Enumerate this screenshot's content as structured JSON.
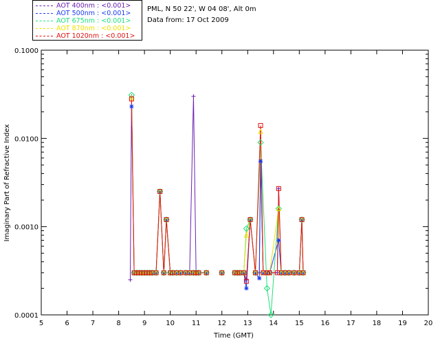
{
  "header": {
    "location": "PML, N 50 22', W 04 08', Alt 0m",
    "date_line": "Data from: 17 Oct 2009"
  },
  "legend": [
    {
      "label": "AOT  400nm : <0.001>",
      "color": "#6a1fb0"
    },
    {
      "label": "AOT  500nm : <0.001>",
      "color": "#1a3cf0"
    },
    {
      "label": "AOT  675nm : <0.001>",
      "color": "#1ee07a"
    },
    {
      "label": "AOT  870nm : <0.001>",
      "color": "#f0e000"
    },
    {
      "label": "AOT 1020nm : <0.001>",
      "color": "#e01010"
    }
  ],
  "chart_data": {
    "type": "line",
    "xlabel": "Time (GMT)",
    "ylabel": "Imaginary Part of Refractive Index",
    "xlim": [
      5,
      20
    ],
    "ylim": [
      0.0001,
      0.1
    ],
    "yscale": "log",
    "xticks": [
      "5",
      "6",
      "7",
      "8",
      "9",
      "10",
      "11",
      "12",
      "13",
      "14",
      "15",
      "16",
      "17",
      "18",
      "19",
      "20"
    ],
    "yticks": [
      {
        "value": 0.0001,
        "label": "0.0001"
      },
      {
        "value": 0.001,
        "label": "0.0010"
      },
      {
        "value": 0.01,
        "label": "0.0100"
      },
      {
        "value": 0.1,
        "label": "0.1000"
      }
    ],
    "series": [
      {
        "name": "AOT  400nm : <0.001>",
        "color": "#6a1fb0",
        "marker": "plus",
        "points": [
          [
            8.45,
            0.00025
          ],
          [
            8.5,
            0.03
          ],
          [
            8.6,
            0.0003
          ],
          [
            8.7,
            0.0003
          ],
          [
            8.8,
            0.0003
          ],
          [
            8.9,
            0.0003
          ],
          [
            9.0,
            0.0003
          ],
          [
            9.1,
            0.0003
          ],
          [
            9.2,
            0.0003
          ],
          [
            9.3,
            0.0003
          ],
          [
            9.45,
            0.0003
          ],
          [
            9.6,
            0.0025
          ],
          [
            9.75,
            0.0003
          ],
          [
            9.85,
            0.0012
          ],
          [
            10.0,
            0.0003
          ],
          [
            10.1,
            0.0003
          ],
          [
            10.25,
            0.0003
          ],
          [
            10.4,
            0.0003
          ],
          [
            10.6,
            0.0003
          ],
          [
            10.75,
            0.0003
          ],
          [
            10.9,
            0.03
          ],
          [
            11.0,
            0.0003
          ],
          [
            11.1,
            0.0003
          ],
          [
            11.4,
            0.0003
          ],
          [
            12.0,
            0.0003
          ],
          [
            12.5,
            0.0003
          ],
          [
            12.6,
            0.0003
          ],
          [
            12.7,
            0.0003
          ],
          [
            12.85,
            0.0003
          ],
          [
            12.95,
            0.00025
          ],
          [
            13.1,
            0.0012
          ],
          [
            13.3,
            0.0003
          ],
          [
            13.45,
            0.0003
          ],
          [
            13.5,
            0.0055
          ],
          [
            13.6,
            0.0003
          ],
          [
            13.75,
            0.0003
          ],
          [
            13.85,
            0.0003
          ],
          [
            14.15,
            0.0003
          ],
          [
            14.2,
            0.0027
          ],
          [
            14.3,
            0.0003
          ],
          [
            14.45,
            0.0003
          ],
          [
            14.6,
            0.0003
          ],
          [
            14.8,
            0.0003
          ],
          [
            15.0,
            0.0003
          ],
          [
            15.1,
            0.0012
          ],
          [
            15.15,
            0.0003
          ]
        ]
      },
      {
        "name": "AOT  500nm : <0.001>",
        "color": "#1a3cf0",
        "marker": "star",
        "points": [
          [
            8.5,
            0.023
          ],
          [
            8.6,
            0.0003
          ],
          [
            8.7,
            0.0003
          ],
          [
            8.8,
            0.0003
          ],
          [
            8.9,
            0.0003
          ],
          [
            9.0,
            0.0003
          ],
          [
            9.1,
            0.0003
          ],
          [
            9.2,
            0.0003
          ],
          [
            9.3,
            0.0003
          ],
          [
            9.45,
            0.0003
          ],
          [
            9.6,
            0.0025
          ],
          [
            9.75,
            0.0003
          ],
          [
            9.85,
            0.0012
          ],
          [
            10.0,
            0.0003
          ],
          [
            10.1,
            0.0003
          ],
          [
            10.25,
            0.0003
          ],
          [
            10.4,
            0.0003
          ],
          [
            10.6,
            0.0003
          ],
          [
            10.75,
            0.0003
          ],
          [
            10.9,
            0.0003
          ],
          [
            11.0,
            0.0003
          ],
          [
            11.1,
            0.0003
          ],
          [
            11.4,
            0.0003
          ],
          [
            12.0,
            0.0003
          ],
          [
            12.5,
            0.0003
          ],
          [
            12.6,
            0.0003
          ],
          [
            12.7,
            0.0003
          ],
          [
            12.85,
            0.0003
          ],
          [
            12.95,
            0.0002
          ],
          [
            13.1,
            0.0012
          ],
          [
            13.3,
            0.0003
          ],
          [
            13.45,
            0.00026
          ],
          [
            13.5,
            0.0055
          ],
          [
            13.6,
            0.0003
          ],
          [
            13.75,
            0.0003
          ],
          [
            13.85,
            0.0003
          ],
          [
            14.2,
            0.0007
          ],
          [
            14.3,
            0.0003
          ],
          [
            14.45,
            0.0003
          ],
          [
            14.6,
            0.0003
          ],
          [
            14.8,
            0.0003
          ],
          [
            15.0,
            0.0003
          ],
          [
            15.1,
            0.0012
          ],
          [
            15.15,
            0.0003
          ]
        ]
      },
      {
        "name": "AOT  675nm : <0.001>",
        "color": "#1ee07a",
        "marker": "diamond",
        "points": [
          [
            8.5,
            0.031
          ],
          [
            8.6,
            0.0003
          ],
          [
            8.7,
            0.0003
          ],
          [
            8.8,
            0.0003
          ],
          [
            8.9,
            0.0003
          ],
          [
            9.0,
            0.0003
          ],
          [
            9.1,
            0.0003
          ],
          [
            9.2,
            0.0003
          ],
          [
            9.3,
            0.0003
          ],
          [
            9.45,
            0.0003
          ],
          [
            9.6,
            0.0025
          ],
          [
            9.75,
            0.0003
          ],
          [
            9.85,
            0.0012
          ],
          [
            10.0,
            0.0003
          ],
          [
            10.1,
            0.0003
          ],
          [
            10.25,
            0.0003
          ],
          [
            10.4,
            0.0003
          ],
          [
            10.6,
            0.0003
          ],
          [
            10.75,
            0.0003
          ],
          [
            10.9,
            0.0003
          ],
          [
            11.0,
            0.0003
          ],
          [
            11.1,
            0.0003
          ],
          [
            11.4,
            0.0003
          ],
          [
            12.0,
            0.0003
          ],
          [
            12.5,
            0.0003
          ],
          [
            12.6,
            0.0003
          ],
          [
            12.7,
            0.0003
          ],
          [
            12.85,
            0.0003
          ],
          [
            12.95,
            0.00095
          ],
          [
            13.1,
            0.0012
          ],
          [
            13.3,
            0.0003
          ],
          [
            13.5,
            0.009
          ],
          [
            13.75,
            0.0002
          ],
          [
            13.9,
            0.0001
          ],
          [
            14.2,
            0.0016
          ],
          [
            14.3,
            0.0003
          ],
          [
            14.45,
            0.0003
          ],
          [
            14.6,
            0.0003
          ],
          [
            14.8,
            0.0003
          ],
          [
            15.0,
            0.0003
          ],
          [
            15.1,
            0.0012
          ],
          [
            15.15,
            0.0003
          ]
        ]
      },
      {
        "name": "AOT  870nm : <0.001>",
        "color": "#f0e000",
        "marker": "triangle",
        "points": [
          [
            8.5,
            0.029
          ],
          [
            8.6,
            0.0003
          ],
          [
            8.7,
            0.0003
          ],
          [
            8.8,
            0.0003
          ],
          [
            8.9,
            0.0003
          ],
          [
            9.0,
            0.0003
          ],
          [
            9.1,
            0.0003
          ],
          [
            9.2,
            0.0003
          ],
          [
            9.3,
            0.0003
          ],
          [
            9.45,
            0.0003
          ],
          [
            9.6,
            0.0025
          ],
          [
            9.75,
            0.0003
          ],
          [
            9.85,
            0.0012
          ],
          [
            10.0,
            0.0003
          ],
          [
            10.1,
            0.0003
          ],
          [
            10.25,
            0.0003
          ],
          [
            10.4,
            0.0003
          ],
          [
            10.6,
            0.0003
          ],
          [
            10.75,
            0.0003
          ],
          [
            10.9,
            0.0003
          ],
          [
            11.0,
            0.0003
          ],
          [
            11.1,
            0.0003
          ],
          [
            11.4,
            0.0003
          ],
          [
            12.0,
            0.0003
          ],
          [
            12.5,
            0.0003
          ],
          [
            12.6,
            0.0003
          ],
          [
            12.7,
            0.0003
          ],
          [
            12.85,
            0.0003
          ],
          [
            12.95,
            0.0008
          ],
          [
            13.1,
            0.0012
          ],
          [
            13.3,
            0.0003
          ],
          [
            13.5,
            0.012
          ],
          [
            13.6,
            0.0003
          ],
          [
            13.75,
            0.0003
          ],
          [
            13.85,
            0.0003
          ],
          [
            14.2,
            0.0016
          ],
          [
            14.3,
            0.0003
          ],
          [
            14.45,
            0.0003
          ],
          [
            14.6,
            0.0003
          ],
          [
            14.8,
            0.0003
          ],
          [
            15.0,
            0.0003
          ],
          [
            15.1,
            0.0012
          ],
          [
            15.15,
            0.0003
          ]
        ]
      },
      {
        "name": "AOT 1020nm : <0.001>",
        "color": "#e01010",
        "marker": "square",
        "points": [
          [
            8.5,
            0.028
          ],
          [
            8.6,
            0.0003
          ],
          [
            8.7,
            0.0003
          ],
          [
            8.8,
            0.0003
          ],
          [
            8.9,
            0.0003
          ],
          [
            9.0,
            0.0003
          ],
          [
            9.1,
            0.0003
          ],
          [
            9.2,
            0.0003
          ],
          [
            9.3,
            0.0003
          ],
          [
            9.45,
            0.0003
          ],
          [
            9.6,
            0.0025
          ],
          [
            9.75,
            0.0003
          ],
          [
            9.85,
            0.0012
          ],
          [
            10.0,
            0.0003
          ],
          [
            10.1,
            0.0003
          ],
          [
            10.25,
            0.0003
          ],
          [
            10.4,
            0.0003
          ],
          [
            10.6,
            0.0003
          ],
          [
            10.75,
            0.0003
          ],
          [
            10.9,
            0.0003
          ],
          [
            11.0,
            0.0003
          ],
          [
            11.1,
            0.0003
          ],
          [
            11.4,
            0.0003
          ],
          [
            12.0,
            0.0003
          ],
          [
            12.5,
            0.0003
          ],
          [
            12.6,
            0.0003
          ],
          [
            12.7,
            0.0003
          ],
          [
            12.85,
            0.0003
          ],
          [
            12.95,
            0.00024
          ],
          [
            13.1,
            0.0012
          ],
          [
            13.3,
            0.0003
          ],
          [
            13.5,
            0.014
          ],
          [
            13.6,
            0.0003
          ],
          [
            13.75,
            0.0003
          ],
          [
            13.85,
            0.0003
          ],
          [
            14.15,
            0.0003
          ],
          [
            14.2,
            0.0027
          ],
          [
            14.3,
            0.0003
          ],
          [
            14.45,
            0.0003
          ],
          [
            14.6,
            0.0003
          ],
          [
            14.8,
            0.0003
          ],
          [
            15.0,
            0.0003
          ],
          [
            15.1,
            0.0012
          ],
          [
            15.15,
            0.0003
          ]
        ]
      }
    ]
  }
}
